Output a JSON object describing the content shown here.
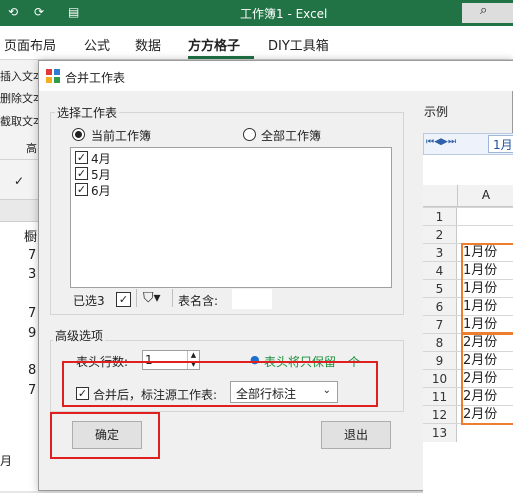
{
  "excel": {
    "title": "工作簿1  -  Excel",
    "tabs": [
      "页面布局",
      "公式",
      "数据",
      "方方格子",
      "DIY工具箱"
    ],
    "active_tab": "方方格子",
    "side_items": [
      "插入文本",
      "删除文本",
      "截取文本",
      "高"
    ],
    "left_cells": [
      "橱",
      "7",
      "3",
      "7",
      "9",
      "8",
      "7"
    ],
    "bottom_left": "月"
  },
  "dialog": {
    "title": "合并工作表",
    "select_group": "选择工作表",
    "radio_current": "当前工作簿",
    "radio_all": "全部工作簿",
    "sheets": [
      "4月",
      "5月",
      "6月"
    ],
    "selected_count": "已选3",
    "table_name_label": "表名含:",
    "advanced_group": "高级选项",
    "header_rows_label": "表头行数:",
    "header_rows_value": "1",
    "header_note": "表头将只保留一个",
    "mark_source_label": "合并后，标注源工作表:",
    "mark_source_value": "全部行标注",
    "ok": "确定",
    "exit": "退出",
    "example_label": "示例",
    "preview_tab": "1月",
    "preview_col": "A",
    "preview_rows": [
      {
        "n": "1",
        "v": ""
      },
      {
        "n": "2",
        "v": ""
      },
      {
        "n": "3",
        "v": "1月份"
      },
      {
        "n": "4",
        "v": "1月份"
      },
      {
        "n": "5",
        "v": "1月份"
      },
      {
        "n": "6",
        "v": "1月份"
      },
      {
        "n": "7",
        "v": "1月份"
      },
      {
        "n": "8",
        "v": "2月份"
      },
      {
        "n": "9",
        "v": "2月份"
      },
      {
        "n": "10",
        "v": "2月份"
      },
      {
        "n": "11",
        "v": "2月份"
      },
      {
        "n": "12",
        "v": "2月份"
      },
      {
        "n": "13",
        "v": ""
      }
    ]
  },
  "colors": {
    "excel_green": "#217346",
    "highlight_red": "#e02020",
    "preview_orange": "#ed7d31",
    "note_green": "#1a8f3c"
  }
}
